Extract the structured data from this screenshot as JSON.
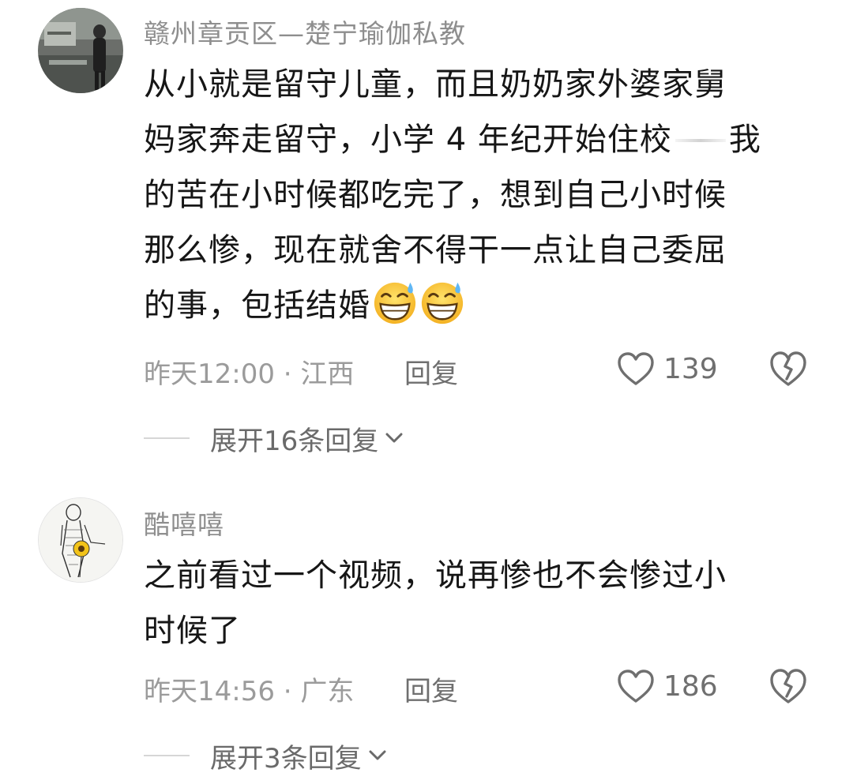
{
  "comments": [
    {
      "username": "赣州章贡区—楚宁瑜伽私教",
      "lines": [
        "从小就是留守儿童，而且奶奶家外婆家舅",
        "妈家奔走留守，小学 4 年纪开始住校",
        "我",
        "的苦在小时候都吃完了，想到自己小时候",
        "那么惨，现在就舍不得干一点让自己委屈",
        "的事，包括结婚"
      ],
      "emojis": [
        "grinning-sweat-emoji",
        "grinning-sweat-emoji"
      ],
      "time_location": "昨天12:00 · 江西",
      "reply_label": "回复",
      "like_count": "139",
      "expand_label": "展开16条回复"
    },
    {
      "username": "酷嘻嘻",
      "lines": [
        "之前看过一个视频，说再惨也不会惨过小",
        "时候了"
      ],
      "time_location": "昨天14:56 · 广东",
      "reply_label": "回复",
      "like_count": "186",
      "expand_label": "展开3条回复"
    }
  ],
  "icons": {
    "like": "heart-outline-icon",
    "dislike": "broken-heart-icon",
    "expand": "chevron-down-icon"
  },
  "colors": {
    "username": "#8e8e8e",
    "body_text": "#161616",
    "meta": "#9b9b9b",
    "action": "#6f6f6f"
  }
}
